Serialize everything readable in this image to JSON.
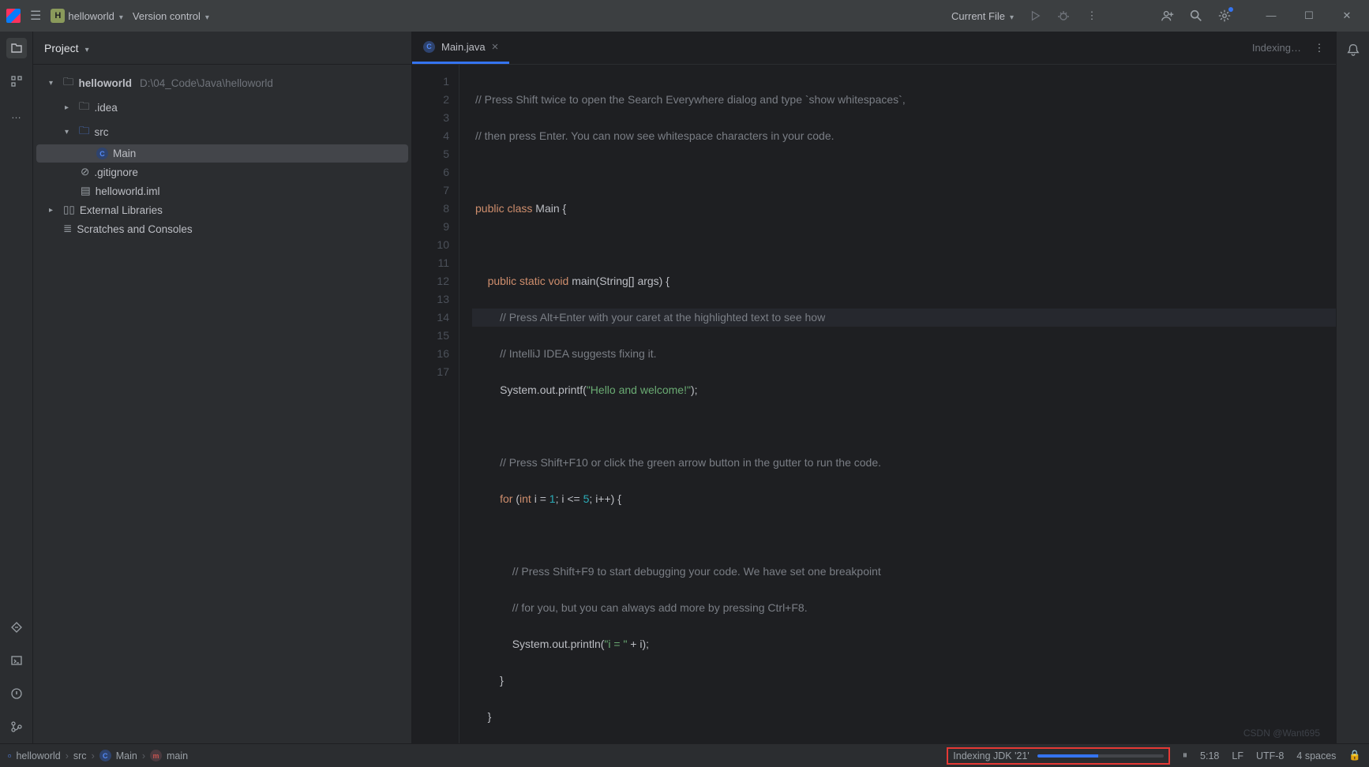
{
  "titlebar": {
    "project_initial": "H",
    "project_name": "helloworld",
    "vcs_label": "Version control",
    "config_label": "Current File"
  },
  "project": {
    "title": "Project",
    "root_name": "helloworld",
    "root_path": "D:\\04_Code\\Java\\helloworld",
    "idea_folder": ".idea",
    "src_folder": "src",
    "main_class": "Main",
    "gitignore": ".gitignore",
    "iml": "helloworld.iml",
    "ext_lib": "External Libraries",
    "scratches": "Scratches and Consoles"
  },
  "editor": {
    "tab_name": "Main.java",
    "indexing_pill": "Indexing…",
    "gutter": [
      "1",
      "2",
      "",
      "3",
      "",
      "4",
      "5",
      "6",
      "7",
      "8",
      "9",
      "10",
      "11",
      "12",
      "13",
      "14",
      "15",
      "16",
      "17"
    ],
    "code": {
      "l1": "// Press Shift twice to open the Search Everywhere dialog and type `show whitespaces`,",
      "l2": "// then press Enter. You can now see whitespace characters in your code.",
      "l3_a": "public",
      "l3_b": "class",
      "l3_c": "Main {",
      "l4_a": "public",
      "l4_b": "static",
      "l4_c": "void",
      "l4_d": "main(String[] args) {",
      "l5": "// Press Alt+Enter with your caret at the highlighted text to see how",
      "l6": "// IntelliJ IDEA suggests fixing it.",
      "l7_a": "System.out.printf(",
      "l7_b": "\"Hello and welcome!\"",
      "l7_c": ");",
      "l9": "// Press Shift+F10 or click the green arrow button in the gutter to run the code.",
      "l10_a": "for",
      "l10_b": "(",
      "l10_c": "int",
      "l10_d": " i = ",
      "l10_e": "1",
      "l10_f": "; i <= ",
      "l10_g": "5",
      "l10_h": "; i++) {",
      "l12": "// Press Shift+F9 to start debugging your code. We have set one breakpoint",
      "l13": "// for you, but you can always add more by pressing Ctrl+F8.",
      "l14_a": "System.out.println(",
      "l14_b": "\"i = \"",
      "l14_c": " + i);",
      "l15": "}",
      "l16": "}",
      "l17": "}"
    }
  },
  "status": {
    "breadcrumbs": [
      "helloworld",
      "src",
      "Main",
      "main"
    ],
    "indexing_text": "Indexing JDK '21'",
    "pause_glyph": "⏸",
    "caret": "5:18",
    "eol": "LF",
    "encoding": "UTF-8",
    "indent": "4 spaces",
    "watermark": "CSDN @Want695"
  }
}
